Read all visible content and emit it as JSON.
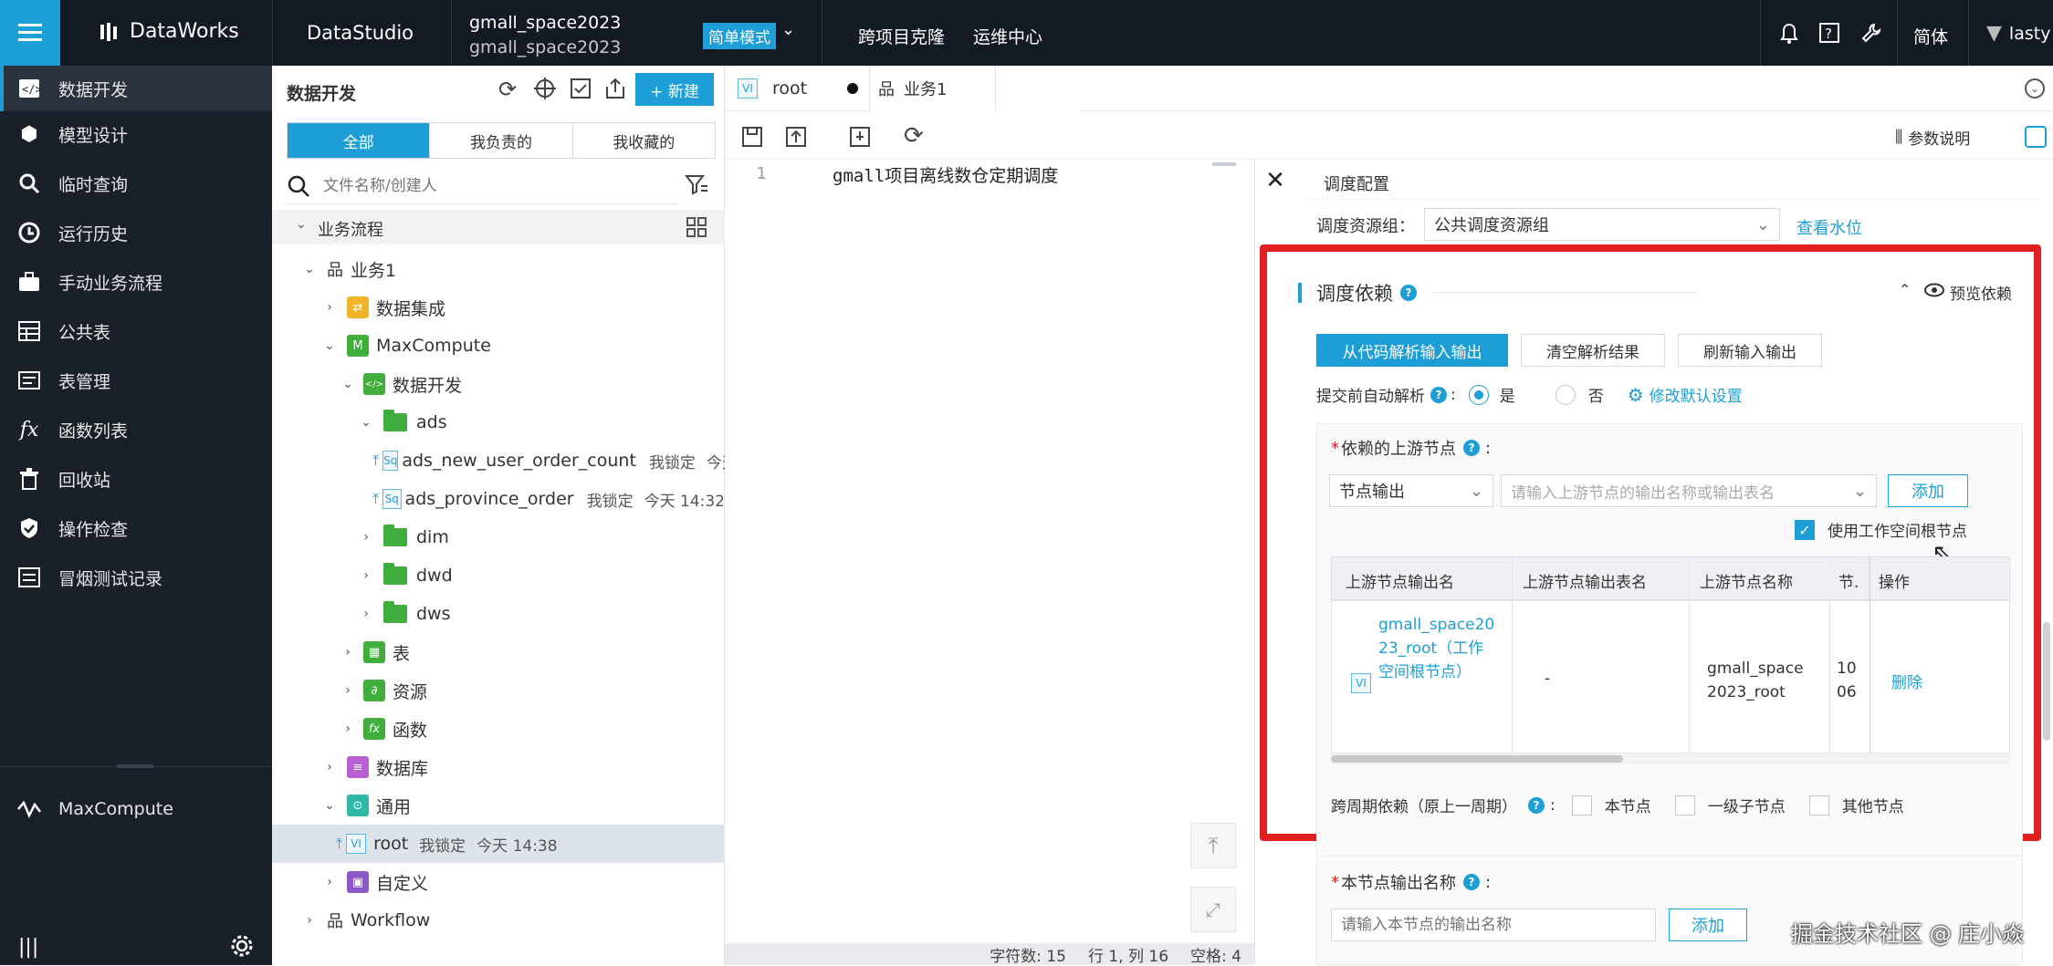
{
  "topbar": {
    "brand": "DataWorks",
    "module": "DataStudio",
    "workspace_line1": "gmall_space2023",
    "workspace_line2": "gmall_space2023",
    "mode_label": "简单模式",
    "links": [
      "跨项目克隆",
      "运维中心"
    ],
    "language": "简体",
    "user": "lasty"
  },
  "sidebar": {
    "items": [
      {
        "label": "数据开发",
        "icon": "code-icon"
      },
      {
        "label": "模型设计",
        "icon": "cube-icon"
      },
      {
        "label": "临时查询",
        "icon": "search-icon"
      },
      {
        "label": "运行历史",
        "icon": "clock-icon"
      },
      {
        "label": "手动业务流程",
        "icon": "briefcase-icon"
      },
      {
        "label": "公共表",
        "icon": "table-icon"
      },
      {
        "label": "表管理",
        "icon": "list-icon"
      },
      {
        "label": "函数列表",
        "icon": "fx-icon"
      },
      {
        "label": "回收站",
        "icon": "trash-icon"
      },
      {
        "label": "操作检查",
        "icon": "shield-icon"
      },
      {
        "label": "冒烟测试记录",
        "icon": "monitor-icon"
      }
    ],
    "bottom_item": "MaxCompute"
  },
  "panel": {
    "title": "数据开发",
    "new_button": "+ 新建",
    "tabs": [
      "全部",
      "我负责的",
      "我收藏的"
    ],
    "search_placeholder": "文件名称/创建人",
    "section": "业务流程",
    "tree": [
      {
        "label": "业务1",
        "level": 0
      },
      {
        "label": "数据集成",
        "level": 1
      },
      {
        "label": "MaxCompute",
        "level": 1
      },
      {
        "label": "数据开发",
        "level": 2
      },
      {
        "label": "ads",
        "level": 3
      },
      {
        "label": "ads_new_user_order_count",
        "status": "我锁定",
        "time": "今天",
        "level": 4
      },
      {
        "label": "ads_province_order",
        "status": "我锁定",
        "time": "今天 14:32",
        "level": 4
      },
      {
        "label": "dim",
        "level": 3
      },
      {
        "label": "dwd",
        "level": 3
      },
      {
        "label": "dws",
        "level": 3
      },
      {
        "label": "表",
        "level": 2
      },
      {
        "label": "资源",
        "level": 2
      },
      {
        "label": "函数",
        "level": 2
      },
      {
        "label": "数据库",
        "level": 1
      },
      {
        "label": "通用",
        "level": 1
      },
      {
        "label": "root",
        "status": "我锁定",
        "time": "今天 14:38",
        "level": 2
      },
      {
        "label": "自定义",
        "level": 1
      },
      {
        "label": "Workflow",
        "level": 0
      }
    ]
  },
  "editor": {
    "tabs": [
      {
        "label": "root",
        "badge": "VI"
      },
      {
        "label": "业务1"
      }
    ],
    "param_help": "参数说明",
    "line_number": "1",
    "code": "gmall项目离线数仓定期调度",
    "status": {
      "chars": "字符数: 15",
      "pos": "行 1, 列 16",
      "indent": "空格: 4"
    }
  },
  "schedule": {
    "title": "调度配置",
    "resource_group_label": "调度资源组：",
    "resource_group_value": "公共调度资源组",
    "water_level_link": "查看水位",
    "dep_title": "调度依赖",
    "preview_dep": "预览依赖",
    "btn_parse": "从代码解析输入输出",
    "btn_clear": "清空解析结果",
    "btn_refresh": "刷新输入输出",
    "auto_parse_label": "提交前自动解析",
    "yes": "是",
    "no": "否",
    "modify_default": "修改默认设置",
    "upstream_label": "依赖的上游节点",
    "upstream_type": "节点输出",
    "upstream_placeholder": "请输入上游节点的输出名称或输出表名",
    "add": "添加",
    "use_root": "使用工作空间根节点",
    "table_headers": [
      "上游节点输出名",
      "上游节点输出表名",
      "上游节点名称",
      "节.",
      "操作"
    ],
    "table_row": {
      "output_name": "gmall_space2023_root（工作空间根节点）",
      "output_table": "-",
      "node_name": "gmall_space2023_root",
      "node_id": "1006",
      "action": "删除",
      "badge": "VI"
    },
    "cross_cycle_label": "跨周期依赖（原上一周期）",
    "cross_cycle_options": [
      "本节点",
      "一级子节点",
      "其他节点"
    ],
    "output_label": "本节点输出名称",
    "output_placeholder": "请输入本节点的输出名称"
  },
  "watermark": "掘金技术社区 @ 庄小焱",
  "colors": {
    "accent": "#1d9ed6",
    "highlight_border": "#e02020",
    "topbar": "#141a24",
    "sidebar": "#1a2029"
  }
}
